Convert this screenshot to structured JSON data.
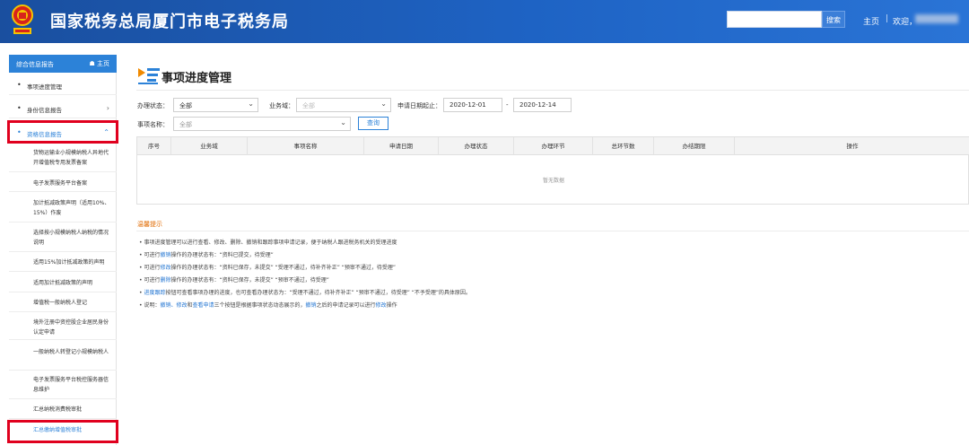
{
  "header": {
    "title": "国家税务总局厦门市电子税务局",
    "search_placeholder": "",
    "search_button": "搜索",
    "home_link": "主页",
    "separator": "|",
    "welcome": "欢迎，"
  },
  "sidebar": {
    "head_title": "综合信息报告",
    "head_home": "主页",
    "items": [
      {
        "label": "事项进度管理"
      },
      {
        "label": "身份信息报告"
      },
      {
        "label": "资格信息报告"
      }
    ],
    "sub_items": [
      {
        "label": "货物运输业小规模纳税人异地代开增值税专用发票备案"
      },
      {
        "label": "电子发票服务平台备案"
      },
      {
        "label": "加计抵减政策声明（适用10%、15%）作废"
      },
      {
        "label": "选择按小规模纳税人纳税的情况说明"
      },
      {
        "label": "适用15%加计抵减政策的声明"
      },
      {
        "label": "适用加计抵减政策的声明"
      },
      {
        "label": "增值税一般纳税人登记"
      },
      {
        "label": "境外注册中资控股企业居民身份认定申请"
      },
      {
        "label": "一般纳税人转登记小规模纳税人"
      },
      {
        "label": "电子发票服务平台税控服务器信息维护"
      },
      {
        "label": "汇总纳税消费税审批"
      },
      {
        "label": "汇总缴纳增值税审批"
      }
    ]
  },
  "main": {
    "title": "事项进度管理",
    "filters": {
      "status_label": "办理状态：",
      "status_value": "全部",
      "domain_label": "业务域：",
      "domain_value": "全部",
      "date_label": "申请日期起止：",
      "date_from": "2020-12-01",
      "date_dash": "-",
      "date_to": "2020-12-14",
      "name_label": "事项名称：",
      "name_value": "全部",
      "query_button": "查询"
    },
    "table": {
      "columns": [
        "序号",
        "业务域",
        "事项名称",
        "申请日期",
        "办理状态",
        "办理环节",
        "总环节数",
        "办结期限",
        "操作"
      ],
      "empty_text": "暂无数据"
    },
    "tips": {
      "title": "温馨提示",
      "lines": [
        [
          "• 事项进度管理可以进行查看、修改、删除、撤销和跟踪事项申请记录，便于纳税人跟进税务机关的受理进度"
        ],
        [
          "• 可进行",
          "撤销",
          "操作的办理状态有：“资料已提交，待受理”"
        ],
        [
          "• 可进行",
          "修改",
          "操作的办理状态有：“资料已保存，未提交”  “受理不通过，待补齐补正”  “预审不通过，待受理”"
        ],
        [
          "• 可进行",
          "删除",
          "操作的办理状态有：“资料已保存，未提交”  “预审不通过，待受理”"
        ],
        [
          "• ",
          "进度跟踪",
          "按钮可查看事项办理的进度，也可查看办理状态为：“受理不通过，待补齐补正”  “预审不通过，待受理”  “不予受理”的具体原因。"
        ],
        [
          "• 说明：",
          "撤销、修改",
          "和",
          "查看申请",
          "三个按钮是根据事项状态动态展示的，",
          "撤销",
          "之后的申请记录可以进行",
          "修改",
          "操作"
        ]
      ]
    }
  },
  "colors": {
    "header_blue": "#1e63c4",
    "accent_blue": "#2c82d8",
    "highlight_red": "#e0001e",
    "tip_orange": "#e06a00"
  }
}
